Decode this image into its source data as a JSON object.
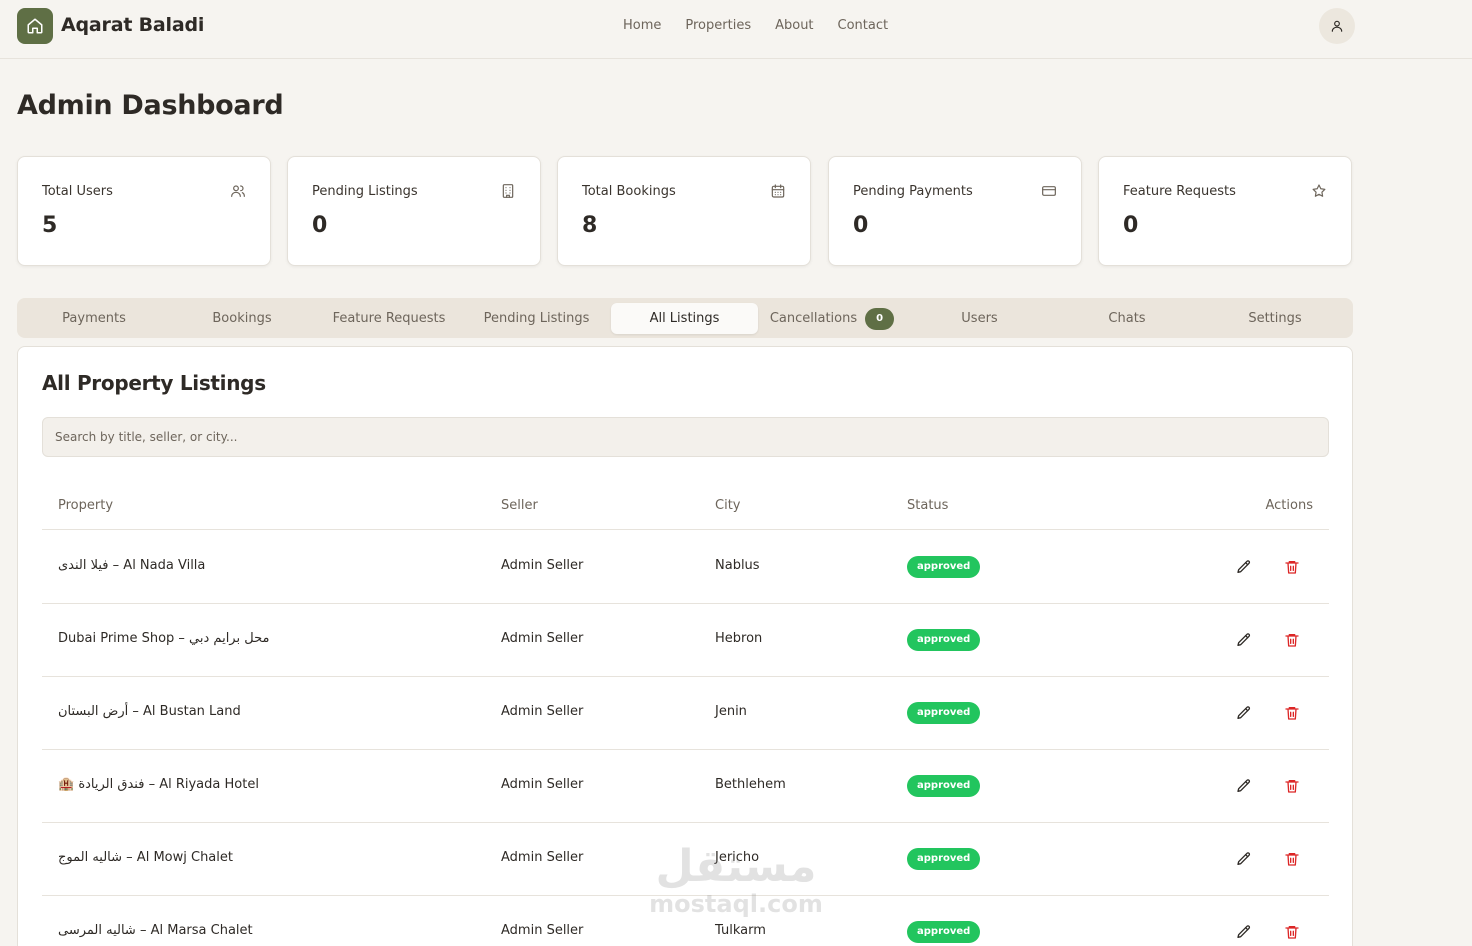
{
  "header": {
    "brand": "Aqarat Baladi",
    "nav": [
      "Home",
      "Properties",
      "About",
      "Contact"
    ]
  },
  "page": {
    "title": "Admin Dashboard"
  },
  "stats": [
    {
      "label": "Total Users",
      "value": "5",
      "icon": "users-icon"
    },
    {
      "label": "Pending Listings",
      "value": "0",
      "icon": "building-icon"
    },
    {
      "label": "Total Bookings",
      "value": "8",
      "icon": "calendar-icon"
    },
    {
      "label": "Pending Payments",
      "value": "0",
      "icon": "credit-card-icon"
    },
    {
      "label": "Feature Requests",
      "value": "0",
      "icon": "star-icon"
    }
  ],
  "tabs": {
    "items": [
      "Payments",
      "Bookings",
      "Feature Requests",
      "Pending Listings",
      "All Listings",
      "Cancellations",
      "Users",
      "Chats",
      "Settings"
    ],
    "active": "All Listings",
    "cancellations_count": "0"
  },
  "listings": {
    "title": "All Property Listings",
    "search_placeholder": "Search by title, seller, or city...",
    "columns": [
      "Property",
      "Seller",
      "City",
      "Status",
      "Actions"
    ],
    "rows": [
      {
        "property": "فيلا الندى – Al Nada Villa",
        "seller": "Admin Seller",
        "city": "Nablus",
        "status": "approved"
      },
      {
        "property": "Dubai Prime Shop – محل برايم دبي",
        "seller": "Admin Seller",
        "city": "Hebron",
        "status": "approved"
      },
      {
        "property": "أرض البستان – Al Bustan Land",
        "seller": "Admin Seller",
        "city": "Jenin",
        "status": "approved"
      },
      {
        "property": "🏨 فندق الريادة – Al Riyada Hotel",
        "seller": "Admin Seller",
        "city": "Bethlehem",
        "status": "approved"
      },
      {
        "property": "شاليه الموج – Al Mowj Chalet",
        "seller": "Admin Seller",
        "city": "Jericho",
        "status": "approved"
      },
      {
        "property": "شاليه المرسى – Al Marsa Chalet",
        "seller": "Admin Seller",
        "city": "Tulkarm",
        "status": "approved"
      }
    ]
  },
  "watermark": {
    "arabic": "مستقل",
    "latin": "mostaql.com"
  },
  "colors": {
    "accent": "#5f6f45",
    "approved": "#22c55e",
    "delete": "#dc2626",
    "background": "#f6f4f0"
  }
}
